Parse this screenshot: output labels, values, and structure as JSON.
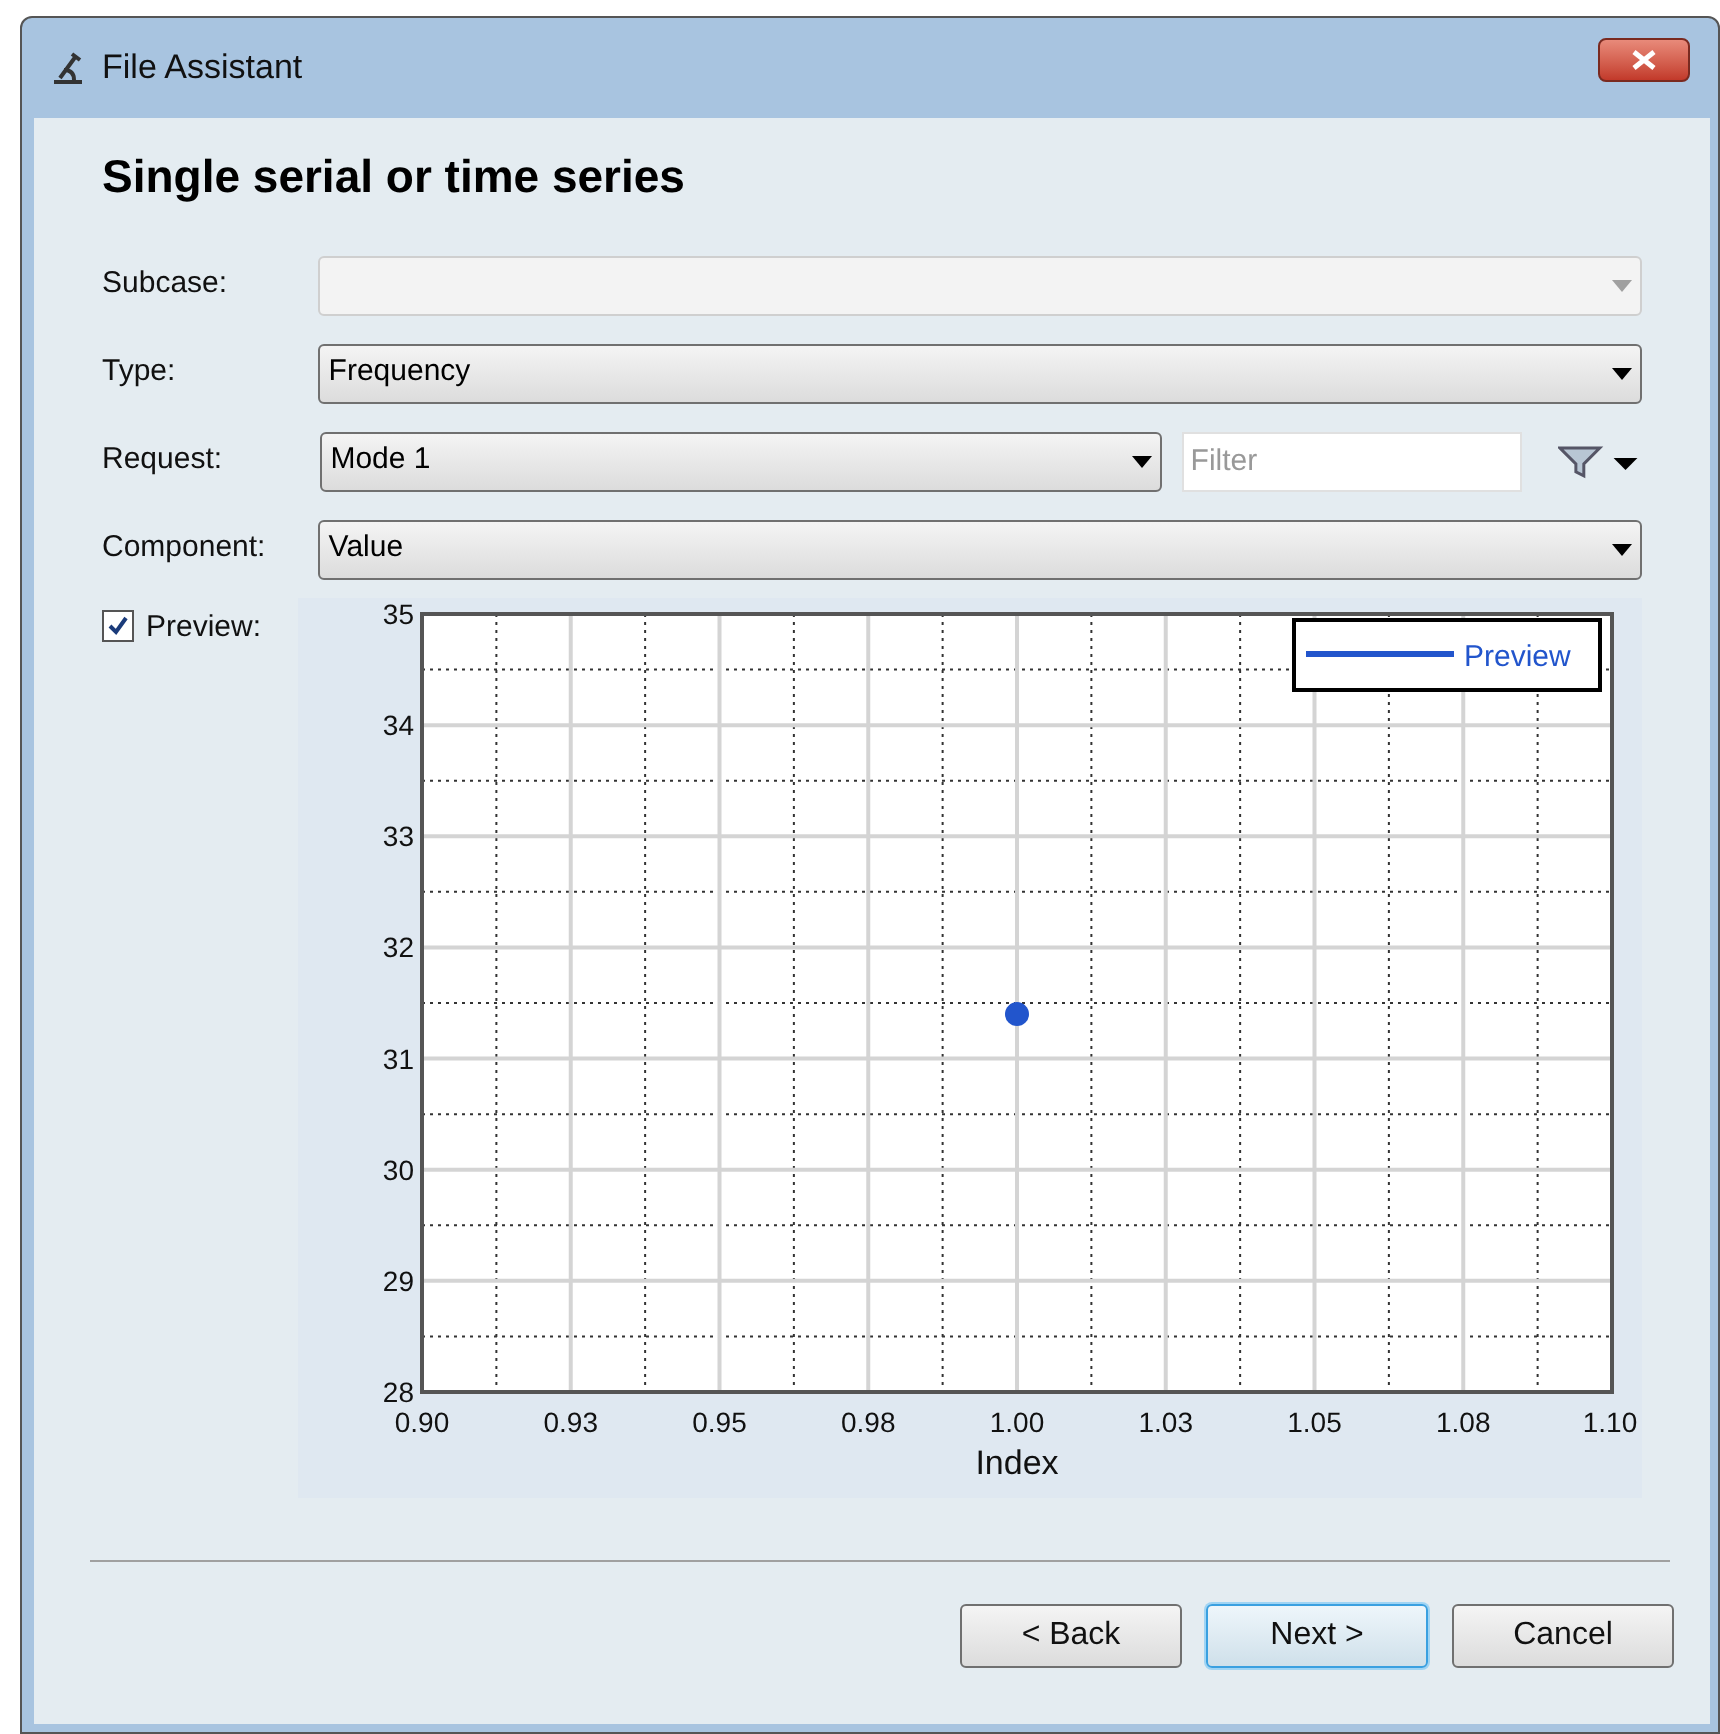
{
  "window": {
    "title": "File Assistant"
  },
  "heading": "Single serial or time series",
  "fields": [
    {
      "label": "Subcase:",
      "disabled": true
    },
    {
      "label": "Type:",
      "value": "Frequency",
      "disabled": false
    },
    {
      "label": "Request:",
      "value": "Mode 1",
      "disabled": false,
      "filter": {
        "placeholder": "Filter"
      }
    },
    {
      "label": "Component:",
      "value": "Value",
      "disabled": false
    }
  ],
  "preview": {
    "label": "Preview:",
    "checked": true,
    "chart_data": {
      "type": "scatter",
      "xlabel": "Index",
      "x": [
        1.0
      ],
      "series": [
        {
          "name": "Preview",
          "color": "#2255cc",
          "values": [
            31.4
          ]
        }
      ],
      "grid": true,
      "xlim": [
        0.9,
        1.1
      ],
      "ylim": [
        28,
        35
      ],
      "xticks": [
        {
          "value": 0.9,
          "label": "0.90"
        },
        {
          "value": 0.925,
          "label": "0.93"
        },
        {
          "value": 0.95,
          "label": "0.95"
        },
        {
          "value": 0.975,
          "label": "0.98"
        },
        {
          "value": 1.0,
          "label": "1.00"
        },
        {
          "value": 1.025,
          "label": "1.03"
        },
        {
          "value": 1.05,
          "label": "1.05"
        },
        {
          "value": 1.075,
          "label": "1.08"
        },
        {
          "value": 1.1,
          "label": "1.10"
        }
      ],
      "yticks": [
        28,
        29,
        30,
        31,
        32,
        33,
        34,
        35
      ]
    }
  },
  "buttons": [
    {
      "label": "< Back",
      "default": false
    },
    {
      "label": "Next >",
      "default": true
    },
    {
      "label": "Cancel",
      "default": false
    }
  ]
}
